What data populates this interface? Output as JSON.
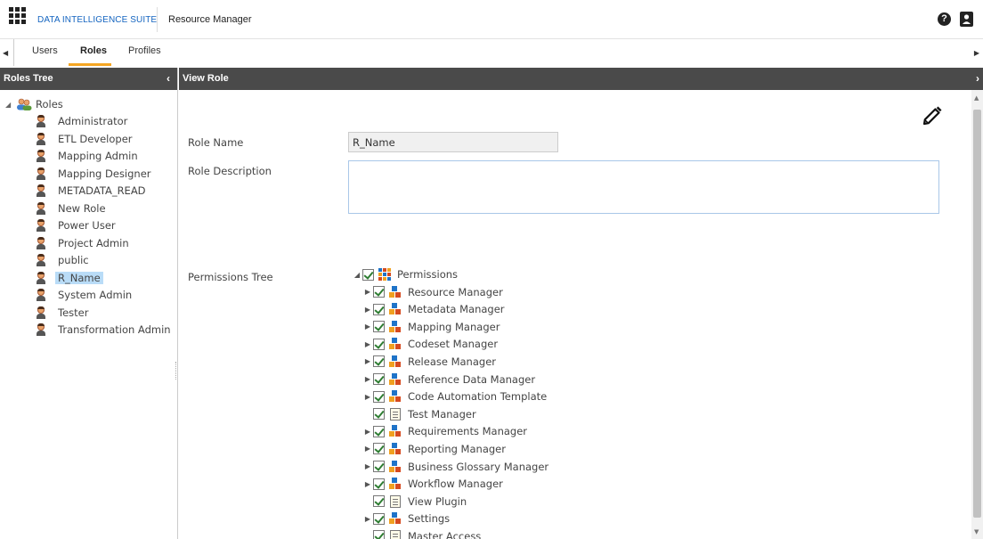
{
  "header": {
    "brand": "DATA INTELLIGENCE SUITE",
    "app_title": "Resource Manager",
    "help_icon": "?"
  },
  "tabs": [
    {
      "label": "Users",
      "active": false
    },
    {
      "label": "Roles",
      "active": true
    },
    {
      "label": "Profiles",
      "active": false
    }
  ],
  "left_panel": {
    "title": "Roles Tree",
    "root_label": "Roles",
    "roles": [
      "Administrator",
      "ETL Developer",
      "Mapping Admin",
      "Mapping Designer",
      "METADATA_READ",
      "New Role",
      "Power User",
      "Project Admin",
      "public",
      "R_Name",
      "System Admin",
      "Tester",
      "Transformation Admin"
    ],
    "selected_role": "R_Name"
  },
  "view_role": {
    "title": "View Role",
    "role_name_label": "Role Name",
    "role_name_value": "R_Name",
    "role_description_label": "Role Description",
    "role_description_value": "",
    "permissions_tree_label": "Permissions Tree",
    "permissions_root": "Permissions",
    "permissions": [
      {
        "label": "Resource Manager",
        "expandable": true,
        "icon": "module-icon"
      },
      {
        "label": "Metadata Manager",
        "expandable": true,
        "icon": "module-icon"
      },
      {
        "label": "Mapping Manager",
        "expandable": true,
        "icon": "module-icon"
      },
      {
        "label": "Codeset Manager",
        "expandable": true,
        "icon": "module-icon"
      },
      {
        "label": "Release Manager",
        "expandable": true,
        "icon": "module-icon"
      },
      {
        "label": "Reference Data Manager",
        "expandable": true,
        "icon": "module-icon"
      },
      {
        "label": "Code Automation Template",
        "expandable": true,
        "icon": "module-icon"
      },
      {
        "label": "Test Manager",
        "expandable": false,
        "icon": "doc-icon"
      },
      {
        "label": "Requirements Manager",
        "expandable": true,
        "icon": "module-icon"
      },
      {
        "label": "Reporting Manager",
        "expandable": true,
        "icon": "module-icon"
      },
      {
        "label": "Business Glossary Manager",
        "expandable": true,
        "icon": "module-icon"
      },
      {
        "label": "Workflow Manager",
        "expandable": true,
        "icon": "module-icon"
      },
      {
        "label": "View Plugin",
        "expandable": false,
        "icon": "doc-icon"
      },
      {
        "label": "Settings",
        "expandable": true,
        "icon": "module-icon"
      },
      {
        "label": "Master Access",
        "expandable": false,
        "icon": "doc-icon"
      }
    ]
  },
  "colors": {
    "header_bg": "#4a4a4a",
    "tab_accent": "#f5a623",
    "brand_blue": "#1565c0",
    "selection": "#b9dcf7",
    "check_green": "#2e7d32"
  }
}
